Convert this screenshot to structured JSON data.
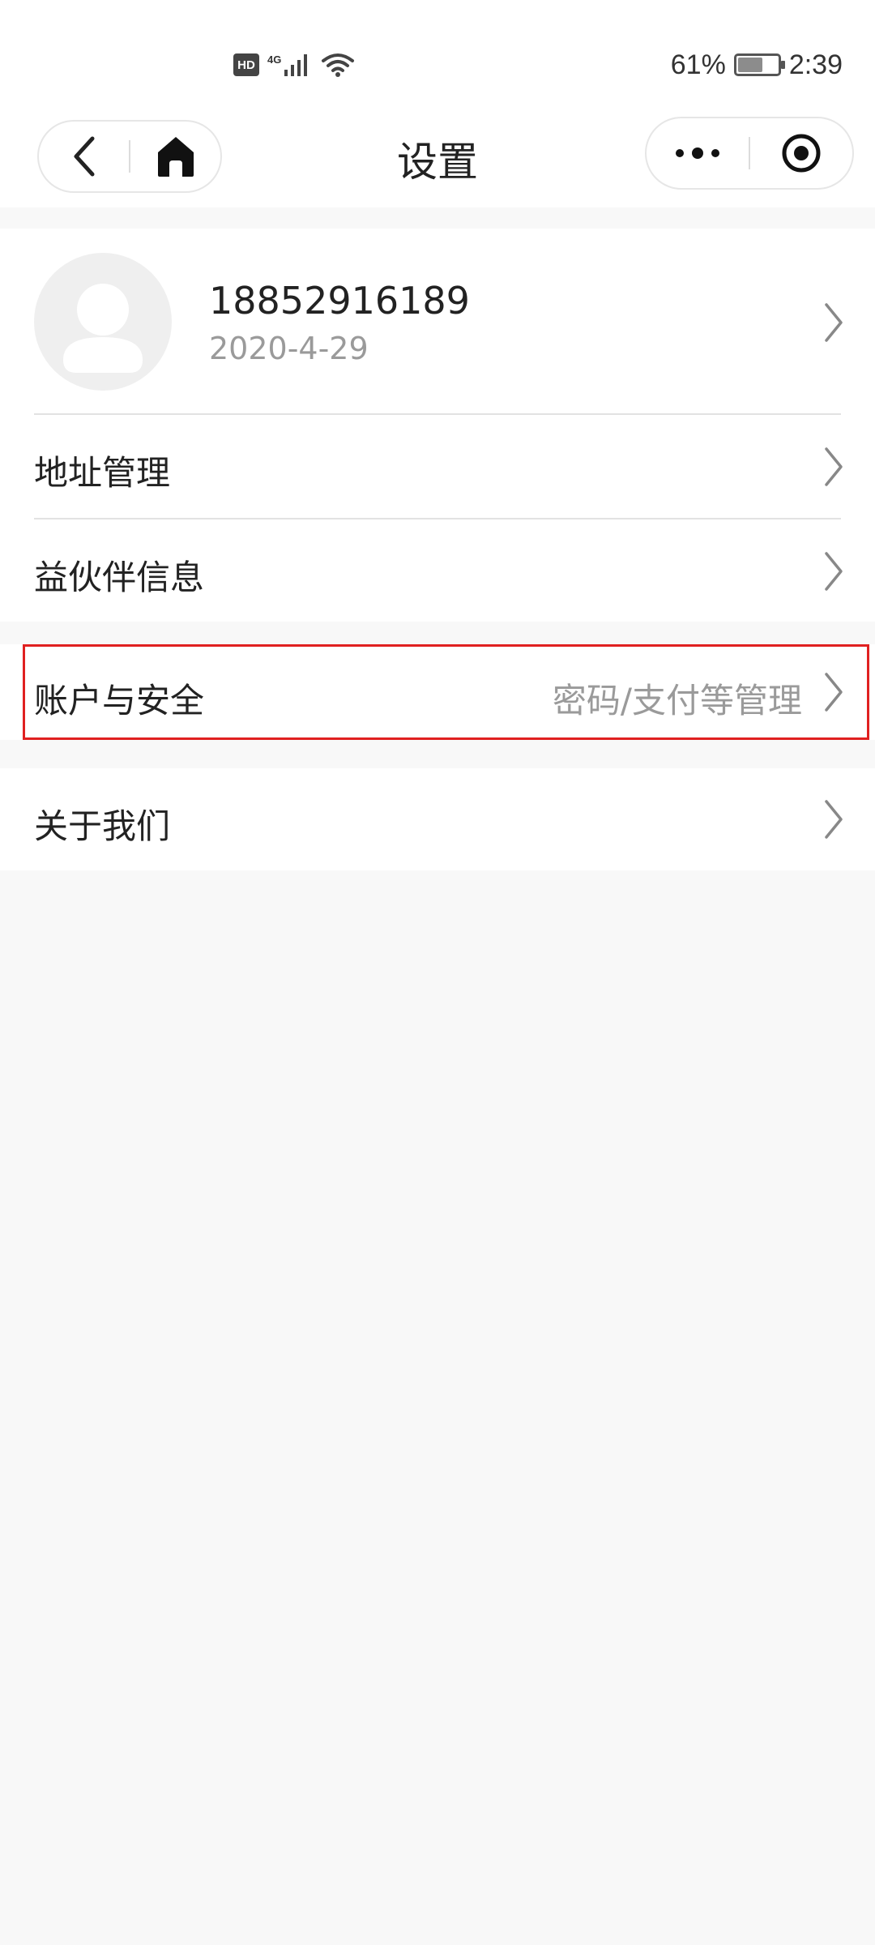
{
  "status_bar": {
    "hd": "HD",
    "network": "4G",
    "battery_percent": "61%",
    "battery_level": 0.61,
    "time": "2:39"
  },
  "nav": {
    "title": "设置",
    "icons": [
      "back-arrow-icon",
      "home-icon",
      "more-dots-icon",
      "record-target-icon"
    ]
  },
  "profile": {
    "phone": "18852916189",
    "date": "2020-4-29"
  },
  "menu": {
    "address": "地址管理",
    "partner": "益伙伴信息",
    "account_label": "账户与安全",
    "account_value": "密码/支付等管理",
    "about": "关于我们"
  },
  "colors": {
    "highlight_border": "#e02020",
    "background": "#f8f8f8",
    "muted_text": "#9a9a9a"
  }
}
